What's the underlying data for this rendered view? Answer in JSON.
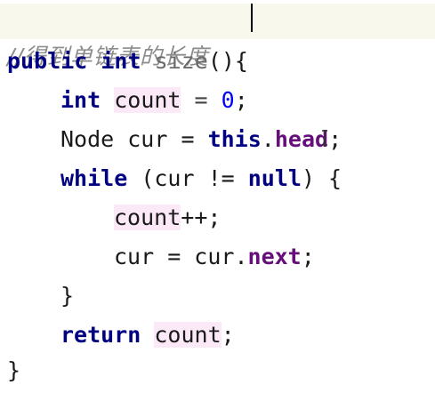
{
  "editor": {
    "comment": "//得到单链表的长度",
    "line1": {
      "kw1": "public",
      "kw2": "int",
      "method": "size",
      "parens": "()",
      "brace": "{"
    },
    "line2": {
      "kw": "int",
      "var": "count",
      "op": " = ",
      "num": "0",
      "semi": ";"
    },
    "line3": {
      "type": "Node cur = ",
      "kw": "this",
      "dot": ".",
      "field": "head",
      "semi": ";"
    },
    "line4": {
      "kw": "while",
      "rest": " (cur != ",
      "kw2": "null",
      "close": ") {"
    },
    "line5": {
      "var": "count",
      "rest": "++;"
    },
    "line6": {
      "text": "cur = cur.",
      "field": "next",
      "semi": ";"
    },
    "line7": {
      "brace": "}"
    },
    "line8": {
      "kw": "return",
      "sp": " ",
      "var": "count",
      "semi": ";"
    },
    "line9": {
      "brace": "}"
    }
  }
}
